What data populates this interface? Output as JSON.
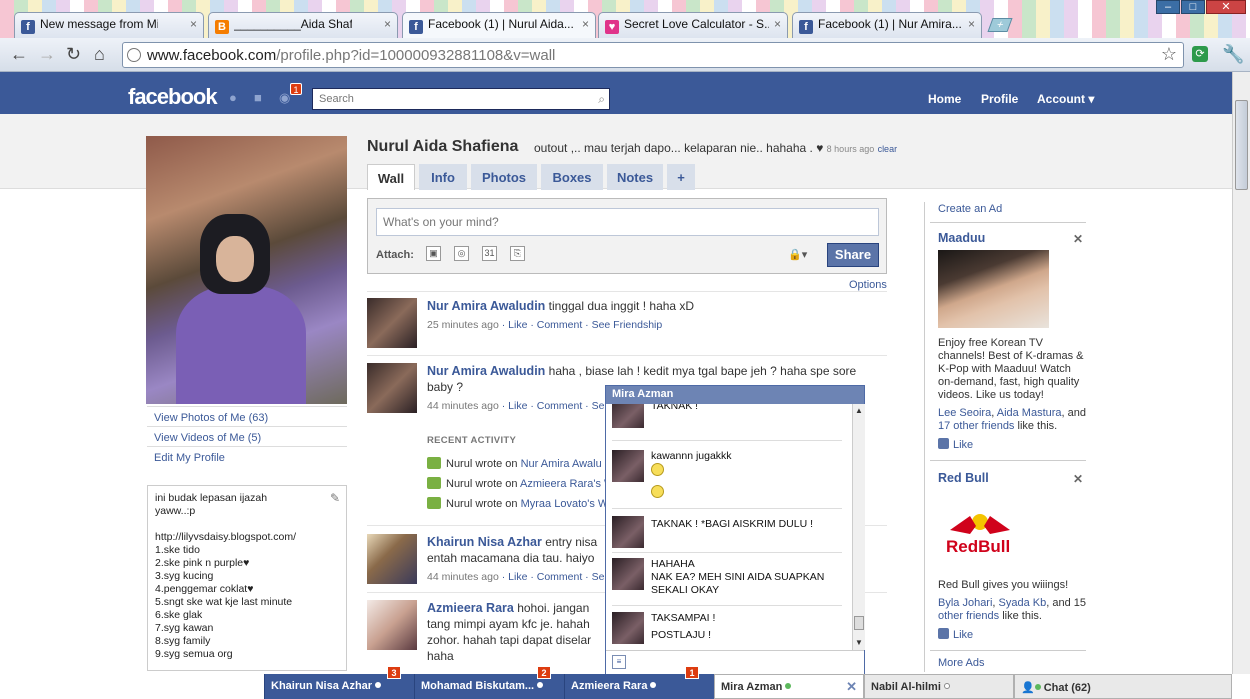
{
  "browser": {
    "tabs": [
      {
        "title": "New message from Mira!",
        "icon": "facebook-icon",
        "color": "#3b5998"
      },
      {
        "title": "__________Aida Shafiena",
        "icon": "blogger-icon",
        "color": "#f57d00"
      },
      {
        "title": "Facebook (1) | Nurul Aida...",
        "icon": "facebook-icon",
        "color": "#3b5998"
      },
      {
        "title": "Secret Love Calculator - S...",
        "icon": "heart-icon",
        "color": "#e0348a"
      },
      {
        "title": "Facebook (1) | Nur Amira...",
        "icon": "facebook-icon",
        "color": "#3b5998"
      }
    ],
    "close_glyph": "×",
    "url_host": "www.facebook.com",
    "url_path": "/profile.php?id=100000932881108&v=wall"
  },
  "fb": {
    "logo": "facebook",
    "notif_count": "1",
    "search_placeholder": "Search",
    "nav": {
      "home": "Home",
      "profile": "Profile",
      "account": "Account ▾"
    }
  },
  "profile": {
    "name": "Nurul Aida Shafiena",
    "status": "outout ,.. mau terjah dapo... kelaparan nie.. hahaha . ♥",
    "status_ago": "8 hours ago",
    "status_clear": "clear",
    "tabs": [
      "Wall",
      "Info",
      "Photos",
      "Boxes",
      "Notes",
      "+"
    ],
    "links": [
      "View Photos of Me (63)",
      "View Videos of Me (5)",
      "Edit My Profile"
    ],
    "bio": [
      "ini budak lepasan ijazah",
      "yaww..:p",
      "",
      "http://lilyvsdaisy.blogspot.com/",
      "1.ske tido",
      "2.ske pink n purple♥",
      "3.syg kucing",
      "4.penggemar coklat♥",
      "5.sngt ske wat kje last minute",
      "6.ske glak",
      "7.syg kawan",
      "8.syg family",
      "9.syg semua org"
    ]
  },
  "composer": {
    "placeholder": "What's on your mind?",
    "attach": "Attach:",
    "share": "Share",
    "options": "Options"
  },
  "stories": [
    {
      "name": "Nur Amira Awaludin",
      "text": "tinggal dua inggit ! haha xD",
      "ago": "25 minutes ago",
      "actions": "· Like · Comment · See Friendship"
    },
    {
      "name": "Nur Amira Awaludin",
      "text": "haha , biase lah ! kedit mya tgal bape jeh ? haha spe sore baby ?",
      "ago": "44 minutes ago",
      "actions": "· Like · Comment · Se"
    },
    {
      "name": "Khairun Nisa Azhar",
      "text": "entry nisa",
      "text2": "entah macamana dia tau. haiyo",
      "ago": "44 minutes ago",
      "actions": "· Like · Comment · Se"
    },
    {
      "name": "Azmieera Rara",
      "text": "hohoi. jangan",
      "text2": "tang mimpi ayam kfc je. hahah",
      "text3": "zohor. hahah tapi dapat diselar",
      "text4": "haha"
    }
  ],
  "recent_activity": {
    "title": "RECENT ACTIVITY",
    "items": [
      {
        "prefix": "Nurul wrote on ",
        "target": "Nur Amira Awalu"
      },
      {
        "prefix": "Nurul wrote on ",
        "target": "Azmieera Rara's W"
      },
      {
        "prefix": "Nurul wrote on ",
        "target": "Myraa Lovato's W"
      }
    ]
  },
  "chat": {
    "title": "Mira Azman",
    "messages": [
      {
        "lines": [
          "TAKNAK !"
        ]
      },
      {
        "lines": [
          "kawannn jugakkk"
        ],
        "smileys": 2
      },
      {
        "lines": [
          "TAKNAK ! *BAGI AISKRIM DULU !"
        ]
      },
      {
        "lines": [
          "HAHAHA",
          "NAK EA? MEH SINI AIDA SUAPKAN",
          "SEKALI OKAY"
        ]
      },
      {
        "lines": [
          "TAKSAMPAI !",
          "POSTLAJU !"
        ]
      }
    ]
  },
  "ads": {
    "create": "Create an Ad",
    "maaduu": {
      "title": "Maaduu",
      "text": "Enjoy free Korean TV channels! Best of K-dramas & K-Pop with Maaduu! Watch on-demand, fast, high quality videos. Like us today!",
      "friends_a": "Lee Seoira",
      "friends_b": "Aida Mastura",
      "and": ", and",
      "others": "17 other friends",
      "suffix": " like this.",
      "like": "Like"
    },
    "redbull": {
      "title": "Red Bull",
      "logo_text": "RedBull",
      "text": "Red Bull gives you wiiings!",
      "friends_a": "Byla Johari",
      "friends_b": "Syada Kb",
      "and": ", and 15",
      "others": "other friends",
      "suffix": " like this.",
      "like": "Like"
    },
    "more": "More Ads"
  },
  "chatbar": {
    "tabs": [
      {
        "name": "Khairun Nisa Azhar",
        "badge": "3"
      },
      {
        "name": "Mohamad Biskutam...",
        "badge": "2"
      },
      {
        "name": "Azmieera Rara",
        "badge": "1"
      },
      {
        "name": "Mira Azman"
      },
      {
        "name": "Nabil Al-hilmi"
      }
    ],
    "chat_label": "Chat (62)"
  },
  "colors": {
    "fb_blue": "#3b5998",
    "badge_red": "#dd3c10",
    "online_green": "#5cb85c"
  }
}
